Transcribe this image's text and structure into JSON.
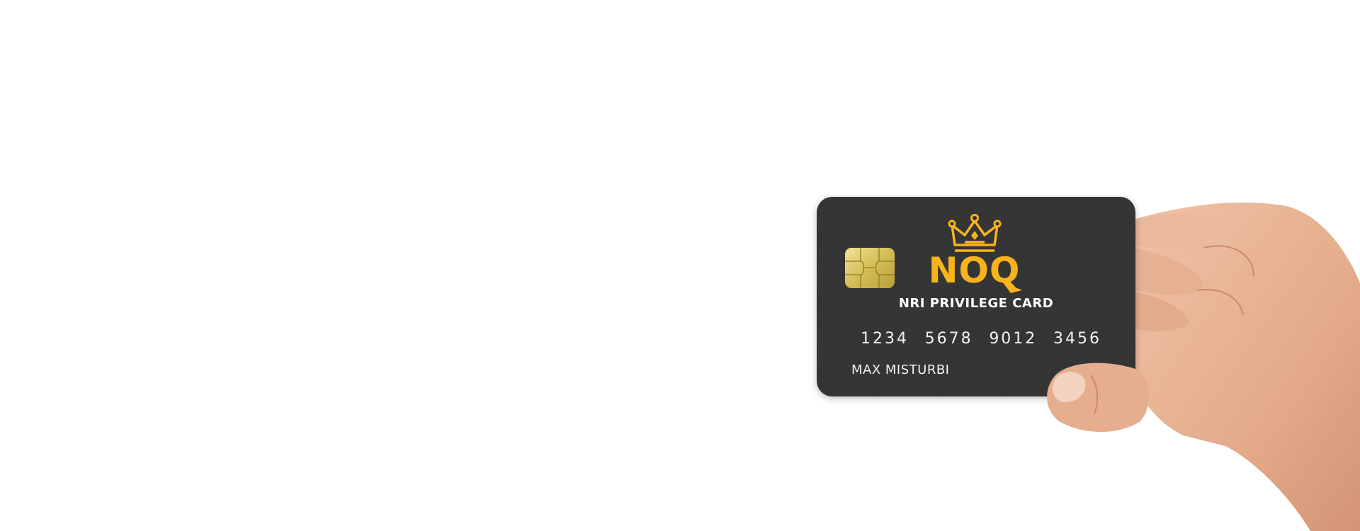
{
  "card": {
    "brand": "NOQ",
    "subtitle": "NRI PRIVILEGE CARD",
    "number_groups": [
      "1234",
      "5678",
      "9012",
      "3456"
    ],
    "holder": "MAX MISTURBI"
  },
  "colors": {
    "background": "#ffffff",
    "card_body": "#333333",
    "brand_gold": "#f6b31c",
    "chip_gold": "#d9c35a",
    "skin": "#e9b596"
  },
  "icons": {
    "crown": "crown-icon",
    "chip": "card-chip-icon"
  }
}
